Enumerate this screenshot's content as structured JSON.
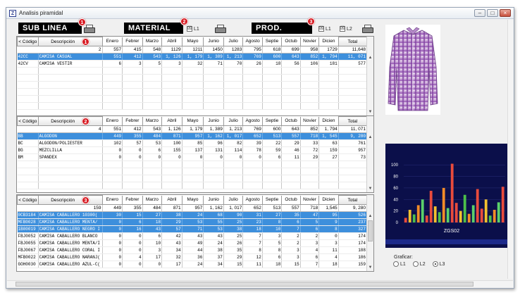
{
  "window": {
    "icon_glyph": "Z",
    "title": "Analisis piramidal",
    "btn_min": "–",
    "btn_max": "□",
    "btn_close": "×"
  },
  "headers": {
    "sublinea": "SUB LINEA",
    "material": "MATERIAL",
    "prod": "PROD.",
    "badge1": "1",
    "badge2": "2",
    "badge3": "3",
    "chk_l1": "L1",
    "chk_l2": "L2",
    "check_mark": "☒"
  },
  "columns": [
    "Enero",
    "Febrer",
    "Marzo",
    "Abril",
    "Mayo",
    "Junio",
    "Julio",
    "Agosto",
    "Septie",
    "Octub",
    "Novier",
    "Dicien",
    "Total"
  ],
  "grid1": {
    "codigo_label": "Código",
    "sort_arrow": "<",
    "descripcion_label": "Descripción",
    "badge": "1",
    "total_count": "2",
    "totals": [
      "557",
      "415",
      "548",
      "1129",
      "1211",
      "1450",
      "1283",
      "795",
      "618",
      "699",
      "958",
      "1729",
      "11,648"
    ],
    "rows": [
      {
        "code": "42CC",
        "desc": "CAMISA CASUAL",
        "values": [
          "551",
          "412",
          "543",
          "1, 126",
          "1, 179",
          "1, 389",
          "1, 213",
          "769",
          "600",
          "643",
          "852",
          "1, 794",
          "11, 071"
        ],
        "selected": true
      },
      {
        "code": "42CV",
        "desc": "CAMISA VESTIR",
        "values": [
          "6",
          "3",
          "5",
          "3",
          "32",
          "71",
          "70",
          "26",
          "18",
          "56",
          "106",
          "181",
          "577"
        ],
        "selected": false
      }
    ]
  },
  "grid2": {
    "codigo_label": "Código",
    "sort_arrow": "<",
    "descripcion_label": "Descripción",
    "badge": "2",
    "total_count": "4",
    "totals": [
      "551",
      "412",
      "543",
      "1, 126",
      "1, 179",
      "1, 389",
      "1, 213",
      "769",
      "600",
      "643",
      "852",
      "1, 794",
      "11, 071"
    ],
    "rows": [
      {
        "code": "BB",
        "desc": "ALGODON",
        "values": [
          "449",
          "355",
          "484",
          "871",
          "957",
          "1, 162",
          "1, 017",
          "652",
          "513",
          "557",
          "718",
          "1, 545",
          "9, 280"
        ],
        "selected": true
      },
      {
        "code": "BC",
        "desc": "ALGODON/POLIESTER",
        "values": [
          "102",
          "57",
          "53",
          "100",
          "85",
          "96",
          "82",
          "39",
          "22",
          "29",
          "33",
          "63",
          "761"
        ],
        "selected": false
      },
      {
        "code": "BG",
        "desc": "MEZCLILLA",
        "values": [
          "0",
          "0",
          "6",
          "155",
          "137",
          "131",
          "114",
          "78",
          "59",
          "46",
          "72",
          "159",
          "957"
        ],
        "selected": false
      },
      {
        "code": "BM",
        "desc": "SPANDEX",
        "values": [
          "0",
          "0",
          "0",
          "0",
          "0",
          "0",
          "0",
          "0",
          "6",
          "11",
          "29",
          "27",
          "73"
        ],
        "selected": false
      }
    ]
  },
  "grid3": {
    "codigo_label": "Código",
    "sort_arrow": "<",
    "descripcion_label": "Descripción",
    "badge": "3",
    "total_count": "159",
    "totals": [
      "449",
      "355",
      "484",
      "871",
      "957",
      "1, 162",
      "1, 017",
      "652",
      "513",
      "557",
      "718",
      "1,545",
      "9, 280"
    ],
    "rows": [
      {
        "code": "0CB3184",
        "desc": "CAMISA CABALLERO 10300(",
        "values": [
          "30",
          "15",
          "27",
          "38",
          "24",
          "68",
          "90",
          "31",
          "27",
          "35",
          "47",
          "95",
          "526"
        ],
        "selected": true
      },
      {
        "code": "MFB0028",
        "desc": "CAMISA CABALLERO MENTA/",
        "values": [
          "0",
          "6",
          "18",
          "29",
          "53",
          "55",
          "25",
          "23",
          "8",
          "6",
          "5",
          "9",
          "237"
        ],
        "selected": true
      },
      {
        "code": "1B00019",
        "desc": "CAMISA CABALLERO NEGRO I",
        "values": [
          "0",
          "16",
          "43",
          "57",
          "71",
          "53",
          "38",
          "18",
          "10",
          "7",
          "6",
          "8",
          "327"
        ],
        "selected": true
      },
      {
        "code": "FBJ0052",
        "desc": "CAMISA CABALLERO BLANCO",
        "values": [
          "0",
          "0",
          "6",
          "42",
          "43",
          "43",
          "25",
          "7",
          "3",
          "2",
          "2",
          "0",
          "174"
        ],
        "selected": false
      },
      {
        "code": "FBJ0055",
        "desc": "CAMISA CABALLERO MENTA/I",
        "values": [
          "0",
          "0",
          "10",
          "43",
          "49",
          "24",
          "26",
          "7",
          "5",
          "2",
          "3",
          "3",
          "174"
        ],
        "selected": false
      },
      {
        "code": "FBJ0067",
        "desc": "CAMISA CABALLERO CORAL I",
        "values": [
          "0",
          "0",
          "3",
          "34",
          "44",
          "38",
          "35",
          "8",
          "8",
          "3",
          "4",
          "11",
          "188"
        ],
        "selected": false
      },
      {
        "code": "MFB0022",
        "desc": "CAMISA CABALLERO NARANJ(",
        "values": [
          "0",
          "4",
          "17",
          "32",
          "36",
          "37",
          "29",
          "12",
          "6",
          "3",
          "6",
          "4",
          "186"
        ],
        "selected": false
      },
      {
        "code": "GOH0030",
        "desc": "CAMISA CABALLERO AZUL-C(",
        "values": [
          "0",
          "0",
          "0",
          "17",
          "24",
          "34",
          "15",
          "11",
          "18",
          "15",
          "7",
          "18",
          "159"
        ],
        "selected": false
      }
    ]
  },
  "chart": {
    "label": "ZGS02",
    "accent": "#d81b23",
    "background": "#0b0f4a",
    "ticks": [
      "100",
      "80",
      "60",
      "40",
      "20",
      "0"
    ],
    "ylim": [
      0,
      110
    ]
  },
  "chart_data": {
    "type": "bar",
    "ylim": [
      0,
      110
    ],
    "series": [
      {
        "values": [
          8,
          22,
          14,
          30,
          40,
          12,
          55,
          28,
          18,
          60,
          25,
          102,
          34,
          20,
          48,
          15,
          30,
          58,
          24,
          40,
          12,
          22,
          35,
          62
        ]
      }
    ]
  },
  "graficar": {
    "label": "Graficar:",
    "options": [
      {
        "label": "L1",
        "checked": false
      },
      {
        "label": "L2",
        "checked": false
      },
      {
        "label": "L3",
        "checked": true
      }
    ]
  },
  "scroll": {
    "up": "▲",
    "down": "▼"
  }
}
